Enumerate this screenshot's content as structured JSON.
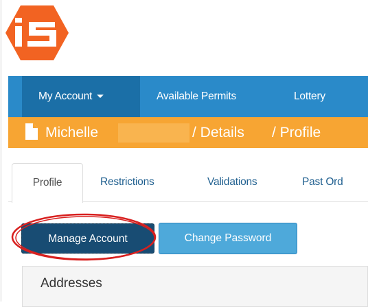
{
  "brand": {
    "logo_text": "iS",
    "logo_color": "#f26322"
  },
  "navbar": {
    "items": [
      {
        "label": "My Account",
        "active": true,
        "has_dropdown": true
      },
      {
        "label": "Available Permits"
      },
      {
        "label": "Lottery"
      }
    ],
    "color": "#2a8ac9",
    "active_color": "#1b6fa7"
  },
  "breadcrumb": {
    "name": "Michelle",
    "items": [
      "/ Details",
      "/ Profile"
    ],
    "color": "#f7a533"
  },
  "tabs": [
    {
      "label": "Profile",
      "active": true
    },
    {
      "label": "Restrictions"
    },
    {
      "label": "Validations"
    },
    {
      "label": "Past Ord"
    }
  ],
  "actions": {
    "manage_account": "Manage Account",
    "change_password": "Change Password"
  },
  "annotation": {
    "color": "#d8201f"
  },
  "panel": {
    "title": "Addresses"
  }
}
